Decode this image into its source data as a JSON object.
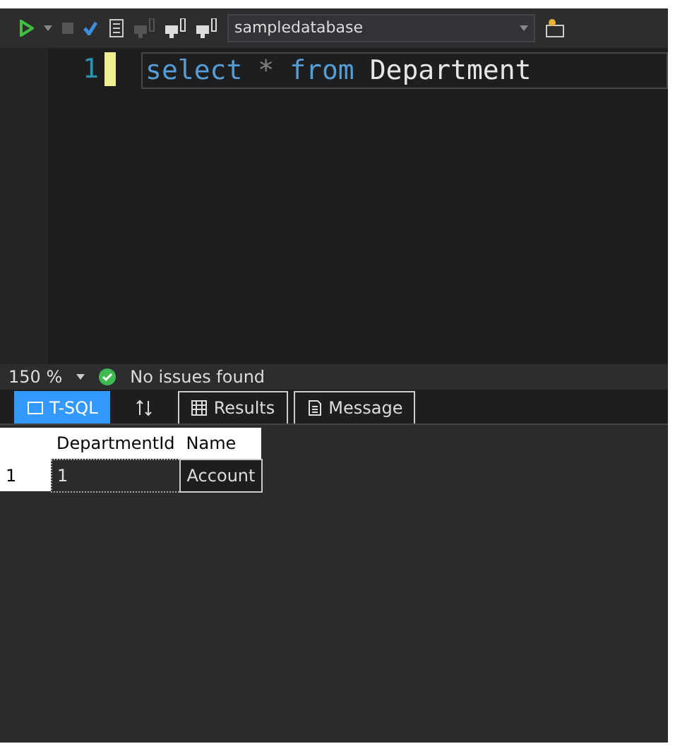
{
  "toolbar": {
    "database": "sampledatabase"
  },
  "editor": {
    "lines": [
      {
        "number": "1",
        "tokens": [
          {
            "kind": "keyword",
            "text": "select"
          },
          {
            "kind": "operator",
            "text": "*"
          },
          {
            "kind": "keyword",
            "text": "from"
          },
          {
            "kind": "identifier",
            "text": "Department"
          }
        ]
      }
    ]
  },
  "status_bar": {
    "zoom": "150 %",
    "issues": "No issues found"
  },
  "tabs": [
    {
      "label": "T-SQL",
      "selected": true
    },
    {
      "label": "Results",
      "selected": false
    },
    {
      "label": "Message",
      "selected": false
    }
  ],
  "results": {
    "columns": [
      "",
      "DepartmentId",
      "Name"
    ],
    "rows": [
      [
        "1",
        "1",
        "Account"
      ]
    ]
  }
}
